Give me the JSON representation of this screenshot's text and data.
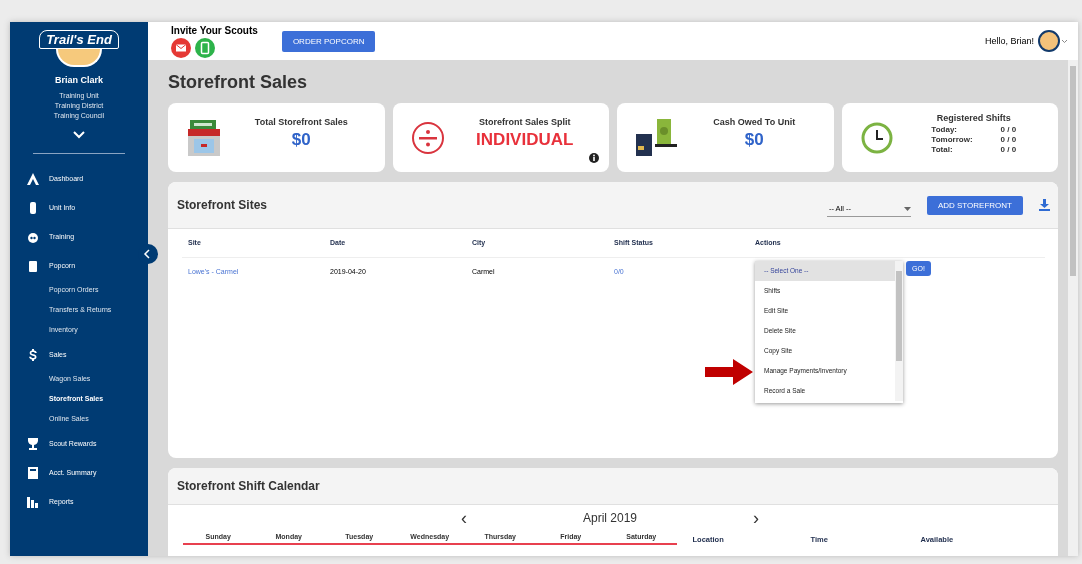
{
  "sidebar": {
    "logo": "Trail's End",
    "user": {
      "name": "Brian Clark",
      "lines": [
        "Training Unit",
        "Training District",
        "Training Council"
      ]
    },
    "items": [
      {
        "label": "Dashboard"
      },
      {
        "label": "Unit Info"
      },
      {
        "label": "Training"
      },
      {
        "label": "Popcorn",
        "children": [
          {
            "label": "Popcorn Orders",
            "selected": false
          },
          {
            "label": "Transfers & Returns",
            "selected": false
          },
          {
            "label": "Inventory",
            "selected": false
          }
        ]
      },
      {
        "label": "Sales",
        "children": [
          {
            "label": "Wagon Sales",
            "selected": false
          },
          {
            "label": "Storefront Sales",
            "selected": true
          },
          {
            "label": "Online Sales",
            "selected": false
          }
        ]
      },
      {
        "label": "Scout Rewards"
      },
      {
        "label": "Acct. Summary"
      },
      {
        "label": "Reports"
      }
    ]
  },
  "header": {
    "invite_title": "Invite Your Scouts",
    "order_button": "ORDER POPCORN",
    "greeting": "Hello, Brian!"
  },
  "page_title": "Storefront Sales",
  "stats": [
    {
      "kind": "value",
      "title": "Total Storefront Sales",
      "value": "$0"
    },
    {
      "kind": "split",
      "title": "Storefront Sales Split",
      "value": "INDIVIDUAL"
    },
    {
      "kind": "value",
      "title": "Cash Owed To Unit",
      "value": "$0"
    },
    {
      "kind": "shifts",
      "title": "Registered Shifts",
      "rows": [
        {
          "label": "Today:",
          "value": "0 / 0"
        },
        {
          "label": "Tomorrow:",
          "value": "0 / 0"
        },
        {
          "label": "Total:",
          "value": "0 / 0"
        }
      ]
    }
  ],
  "sites": {
    "title": "Storefront Sites",
    "filter": "-- All --",
    "add_button": "ADD STOREFRONT",
    "columns": [
      "Site",
      "Date",
      "City",
      "Shift Status",
      "Actions"
    ],
    "rows": [
      {
        "site": "Lowe's - Carmel",
        "date": "2019-04-20",
        "city": "Carmel",
        "shift_status": "0/0"
      }
    ],
    "actions_menu": [
      {
        "label": "-- Select One --",
        "selected": true
      },
      {
        "label": "Shifts",
        "selected": false
      },
      {
        "label": "Edit Site",
        "selected": false
      },
      {
        "label": "Delete Site",
        "selected": false
      },
      {
        "label": "Copy Site",
        "selected": false
      },
      {
        "label": "Manage Payments/Inventory",
        "selected": false
      },
      {
        "label": "Record a Sale",
        "selected": false
      }
    ],
    "go_button": "GO!"
  },
  "calendar": {
    "title": "Storefront Shift Calendar",
    "prev": "‹",
    "month": "April 2019",
    "next": "›",
    "days": [
      "Sunday",
      "Monday",
      "Tuesday",
      "Wednesday",
      "Thursday",
      "Friday",
      "Saturday"
    ],
    "columns": [
      "Location",
      "Time",
      "Available"
    ]
  }
}
